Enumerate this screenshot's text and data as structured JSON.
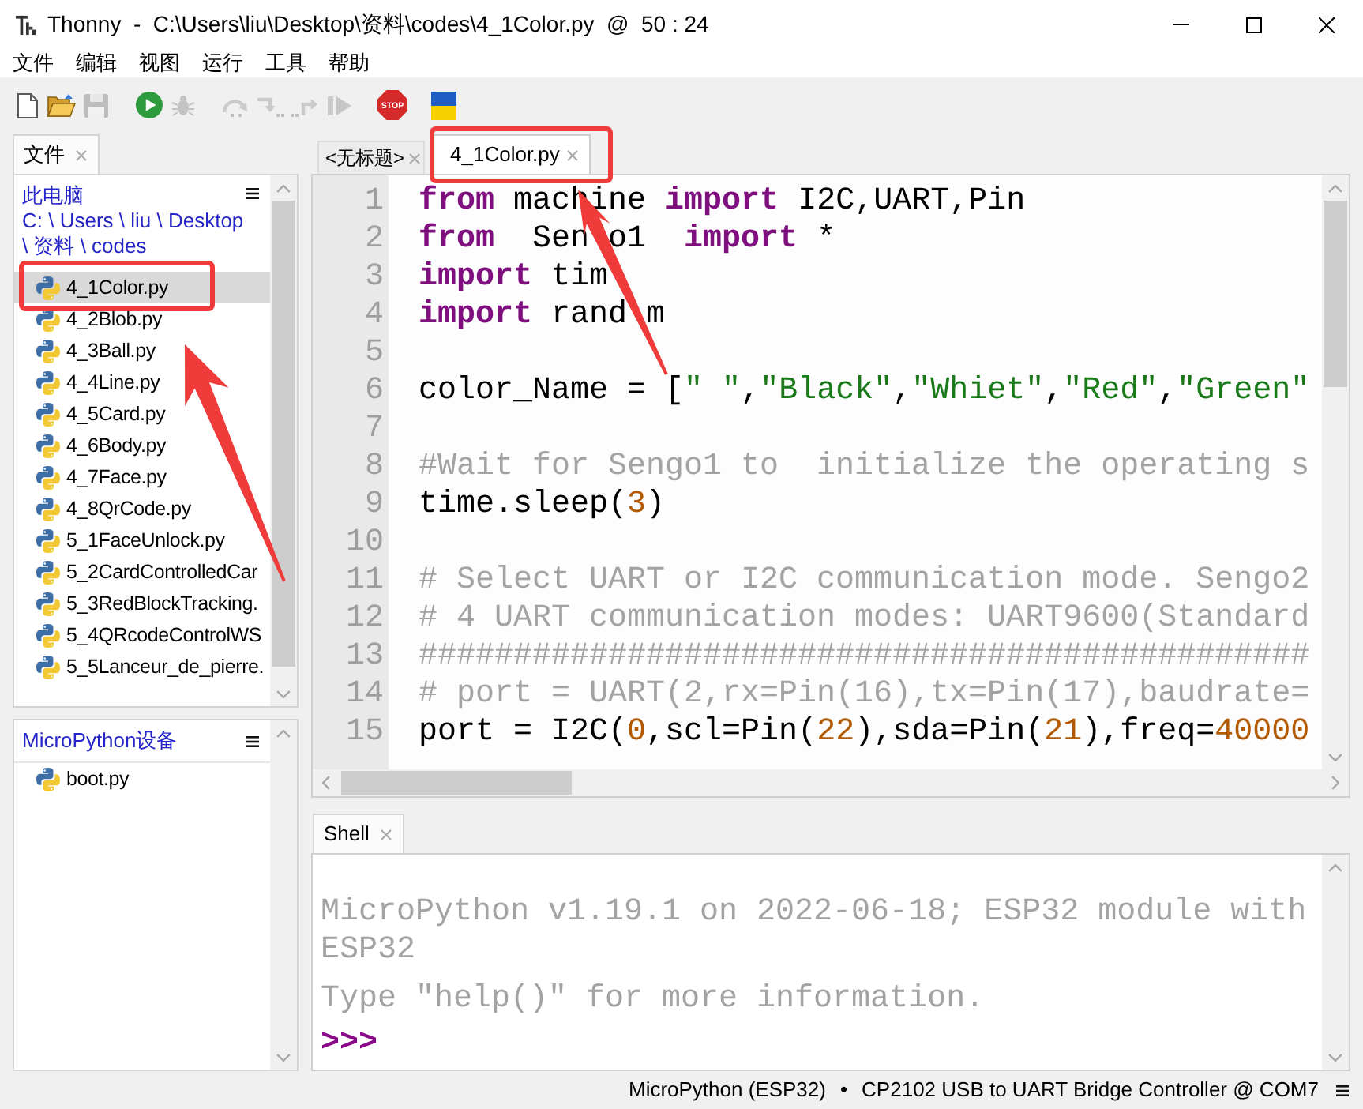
{
  "window": {
    "title": "Thonny  -  C:\\Users\\liu\\Desktop\\资料\\codes\\4_1Color.py  @  50 : 24"
  },
  "menu": [
    "文件",
    "编辑",
    "视图",
    "运行",
    "工具",
    "帮助"
  ],
  "toolbar": [
    [
      {
        "kind": "new",
        "disabled": false
      },
      {
        "kind": "open",
        "disabled": false
      },
      {
        "kind": "save",
        "disabled": true
      }
    ],
    [
      {
        "kind": "run",
        "disabled": false
      },
      {
        "kind": "debug",
        "disabled": true
      }
    ],
    [
      {
        "kind": "step_over",
        "disabled": true
      },
      {
        "kind": "step_into",
        "disabled": true
      },
      {
        "kind": "step_out",
        "disabled": true
      },
      {
        "kind": "resume",
        "disabled": true
      }
    ],
    [
      {
        "kind": "stop",
        "label": "STOP",
        "disabled": false
      }
    ],
    [
      {
        "kind": "flag",
        "disabled": false
      }
    ]
  ],
  "files_panel": {
    "tab": {
      "label": "文件",
      "selected": true
    },
    "location_title": "此电脑",
    "path_lines": [
      "C: \\ Users \\ liu \\ Desktop",
      "\\ 资料 \\ codes"
    ],
    "files": [
      {
        "name": "4_1Color.py",
        "selected": true,
        "highlighted": true
      },
      {
        "name": "4_2Blob.py",
        "selected": false,
        "highlighted": false
      },
      {
        "name": "4_3Ball.py",
        "selected": false,
        "highlighted": false
      },
      {
        "name": "4_4Line.py",
        "selected": false,
        "highlighted": false
      },
      {
        "name": "4_5Card.py",
        "selected": false,
        "highlighted": false
      },
      {
        "name": "4_6Body.py",
        "selected": false,
        "highlighted": false
      },
      {
        "name": "4_7Face.py",
        "selected": false,
        "highlighted": false
      },
      {
        "name": "4_8QrCode.py",
        "selected": false,
        "highlighted": false
      },
      {
        "name": "5_1FaceUnlock.py",
        "selected": false,
        "highlighted": false
      },
      {
        "name": "5_2CardControlledCar",
        "selected": false,
        "highlighted": false
      },
      {
        "name": "5_3RedBlockTracking.",
        "selected": false,
        "highlighted": false
      },
      {
        "name": "5_4QRcodeControlWS",
        "selected": false,
        "highlighted": false
      },
      {
        "name": "5_5Lanceur_de_pierre.",
        "selected": false,
        "highlighted": false
      }
    ]
  },
  "device_panel": {
    "title": "MicroPython设备",
    "files": [
      {
        "name": "boot.py",
        "selected": false
      }
    ]
  },
  "editor": {
    "tabs": [
      {
        "label": "<无标题>",
        "selected": false,
        "highlighted": false
      },
      {
        "label": "4_1Color.py",
        "selected": true,
        "highlighted": true
      }
    ],
    "lines": [
      {
        "number": "1",
        "tokens": [
          {
            "kind": "keyword",
            "text": "from"
          },
          {
            "kind": "plain",
            "text": " machine "
          },
          {
            "kind": "keyword",
            "text": "import"
          },
          {
            "kind": "plain",
            "text": " I2C,UART,Pin"
          }
        ]
      },
      {
        "number": "2",
        "tokens": [
          {
            "kind": "keyword",
            "text": "from"
          },
          {
            "kind": "plain",
            "text": "  Sen"
          },
          {
            "kind": "covered"
          },
          {
            "kind": "plain",
            "text": "o1  "
          },
          {
            "kind": "keyword",
            "text": "import"
          },
          {
            "kind": "plain",
            "text": " *"
          }
        ]
      },
      {
        "number": "3",
        "tokens": [
          {
            "kind": "keyword",
            "text": "import"
          },
          {
            "kind": "plain",
            "text": " tim"
          },
          {
            "kind": "covered"
          }
        ]
      },
      {
        "number": "4",
        "tokens": [
          {
            "kind": "keyword",
            "text": "import"
          },
          {
            "kind": "plain",
            "text": " rand"
          },
          {
            "kind": "covered"
          },
          {
            "kind": "plain",
            "text": "m"
          }
        ]
      },
      {
        "number": "5"
      },
      {
        "number": "6",
        "tokens": [
          {
            "kind": "plain",
            "text": "color_Name = ["
          },
          {
            "kind": "string",
            "text": "\" \""
          },
          {
            "kind": "plain",
            "text": ","
          },
          {
            "kind": "string",
            "text": "\"Black\""
          },
          {
            "kind": "plain",
            "text": ","
          },
          {
            "kind": "string",
            "text": "\"Whiet\""
          },
          {
            "kind": "plain",
            "text": ","
          },
          {
            "kind": "string",
            "text": "\"Red\""
          },
          {
            "kind": "plain",
            "text": ","
          },
          {
            "kind": "string",
            "text": "\"Green\""
          }
        ]
      },
      {
        "number": "7"
      },
      {
        "number": "8",
        "tokens": [
          {
            "kind": "comment",
            "text": "#Wait for Sengo1 to  initialize the operating s"
          }
        ]
      },
      {
        "number": "9",
        "tokens": [
          {
            "kind": "plain",
            "text": "time.sleep("
          },
          {
            "kind": "number",
            "text": "3"
          },
          {
            "kind": "plain",
            "text": ")"
          }
        ]
      },
      {
        "number": "10"
      },
      {
        "number": "11",
        "tokens": [
          {
            "kind": "comment",
            "text": "# Select UART or I2C communication mode. Sengo2"
          }
        ]
      },
      {
        "number": "12",
        "tokens": [
          {
            "kind": "comment",
            "text": "# 4 UART communication modes: UART9600(Standard"
          }
        ]
      },
      {
        "number": "13",
        "tokens": [
          {
            "kind": "comment",
            "text": "###############################################"
          }
        ]
      },
      {
        "number": "14",
        "tokens": [
          {
            "kind": "comment",
            "text": "# port = UART(2,rx=Pin(16),tx=Pin(17),baudrate="
          }
        ]
      },
      {
        "number": "15",
        "tokens": [
          {
            "kind": "plain",
            "text": "port = I2C("
          },
          {
            "kind": "number",
            "text": "0"
          },
          {
            "kind": "plain",
            "text": ",scl=Pin("
          },
          {
            "kind": "number",
            "text": "22"
          },
          {
            "kind": "plain",
            "text": "),sda=Pin("
          },
          {
            "kind": "number",
            "text": "21"
          },
          {
            "kind": "plain",
            "text": "),freq="
          },
          {
            "kind": "number",
            "text": "40000"
          }
        ]
      }
    ]
  },
  "shell": {
    "tab": {
      "label": "Shell",
      "selected": true
    },
    "lines": [
      {
        "kind": "output",
        "text": "MicroPython v1.19.1 on 2022-06-18; ESP32 module with ESP32"
      },
      {
        "kind": "output",
        "text": "Type \"help()\" for more information."
      },
      {
        "kind": "prompt",
        "text": ">>>"
      }
    ]
  },
  "status_bar": {
    "items": [
      "MicroPython (ESP32)",
      "CP2102 USB to UART Bridge Controller @ COM7"
    ],
    "separator": "•"
  }
}
